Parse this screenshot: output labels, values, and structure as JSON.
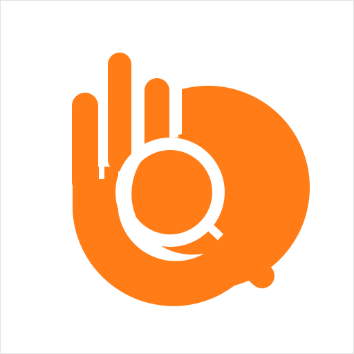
{
  "app_icon": {
    "icon": "hand-magnifier-logo-icon",
    "brand_color": "#FF7C17",
    "background_color": "#FFFFFF",
    "border_color": "#E2E2E2"
  }
}
